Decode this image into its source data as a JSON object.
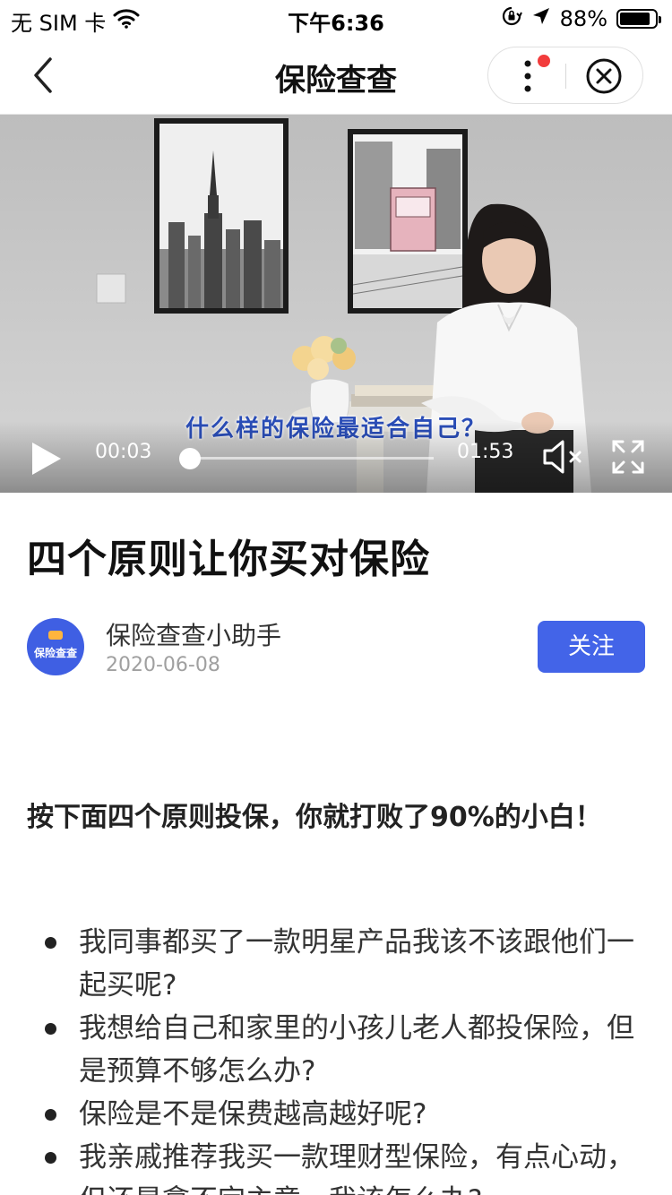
{
  "status_bar": {
    "carrier": "无 SIM 卡",
    "time": "下午6:36",
    "battery": "88%",
    "battery_level": 0.88
  },
  "nav": {
    "title": "保险查查"
  },
  "video": {
    "subtitle": "什么样的保险最适合自己？",
    "current_time": "00:03",
    "total_time": "01:53",
    "progress": 0.027
  },
  "article": {
    "title": "四个原则让你买对保险",
    "author": {
      "avatar_text": "保险查查",
      "name": "保险查查小助手",
      "date": "2020-06-08",
      "follow_label": "关注"
    },
    "lead": "按下面四个原则投保，你就打败了90%的小白！",
    "bullets": [
      "我同事都买了一款明星产品我该不该跟他们一起买呢?",
      "我想给自己和家里的小孩儿老人都投保险，但是预算不够怎么办?",
      "保险是不是保费越高越好呢?",
      "我亲戚推荐我买一款理财型保险，有点心动，但还是拿不定主意，我该怎么办?"
    ]
  },
  "colors": {
    "accent": "#4364e8",
    "notification_dot": "#f23c3c",
    "subtitle": "#2a4db7"
  }
}
